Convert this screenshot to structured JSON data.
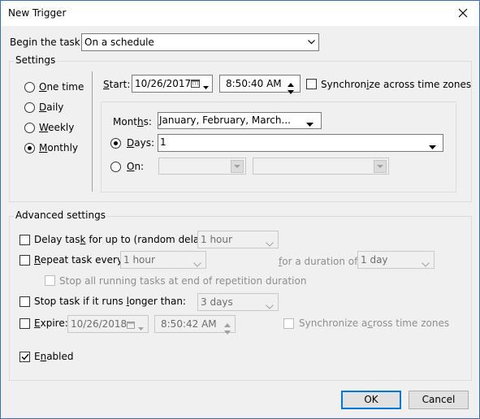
{
  "window": {
    "title": "New Trigger"
  },
  "begin_task": {
    "label": "Begin the task:",
    "value": "On a schedule"
  },
  "settings": {
    "label": "Settings",
    "schedule_options": [
      "One time",
      "Daily",
      "Weekly",
      "Monthly"
    ],
    "selected": "Monthly",
    "start_label": "Start:",
    "start_date": "10/26/2017",
    "start_time": "8:50:40 AM",
    "sync_label": "Synchronize across time zones",
    "months_label": "Months:",
    "months_value": "January, February, March...",
    "days_label": "Days:",
    "days_value": "1",
    "on_label": "On:"
  },
  "advanced": {
    "label": "Advanced settings",
    "delay_label": "Delay task for up to (random delay):",
    "delay_value": "1 hour",
    "repeat_label": "Repeat task every:",
    "repeat_value": "1 hour",
    "duration_label": "for a duration of:",
    "duration_value": "1 day",
    "stop_running_label": "Stop all running tasks at end of repetition duration",
    "stop_longer_label": "Stop task if it runs longer than:",
    "stop_longer_value": "3 days",
    "expire_label": "Expire:",
    "expire_date": "10/26/2018",
    "expire_time": "8:50:42 AM",
    "expire_sync_label": "Synchronize across time zones",
    "enabled_label": "Enabled",
    "enabled": true
  },
  "buttons": {
    "ok": "OK",
    "cancel": "Cancel"
  }
}
